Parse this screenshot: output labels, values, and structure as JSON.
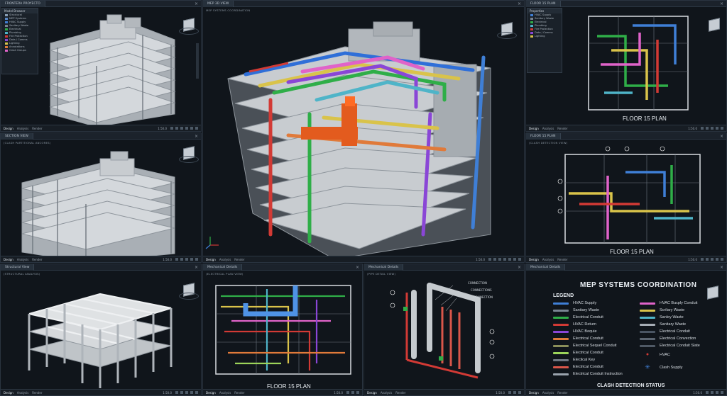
{
  "panes": {
    "p1": {
      "tab": "FRONTERA PROYECTO",
      "footer": [
        "Design",
        "Analysis",
        "Render"
      ],
      "zoom": "1:50.0"
    },
    "p2": {
      "tab": "SECTION VIEW",
      "subtitle": "(CLASH PARTITIONAL ANCORES)",
      "footer": [
        "Design",
        "Analysis",
        "Render"
      ],
      "zoom": "1:50.0"
    },
    "p3": {
      "tab": "Structural View",
      "subtitle": "(STRUCTURAL ANALYSIS)",
      "footer": [
        "Design",
        "Analysis",
        "Render"
      ],
      "zoom": "1:50.0"
    },
    "main": {
      "tab": "MEP 3D VIEW",
      "subtitle": "MEP SYSTEMS COORDINATION",
      "footer": [
        "Design",
        "Analysis",
        "Render"
      ],
      "zoom": "1:50.0"
    },
    "floor_top": {
      "tab": "FLOOR 15 PLAN",
      "footer": [
        "Design",
        "Analysis",
        "Render"
      ],
      "zoom": "1:50.0",
      "label": "FLOOR 15 PLAN"
    },
    "floor_mid": {
      "tab": "FLOOR 15 PLAN",
      "subtitle": "(CLASH DETECTION VIEW)",
      "footer": [
        "Design",
        "Analysis",
        "Render"
      ],
      "zoom": "1:50.0",
      "label": "FLOOR 15 PLAN"
    },
    "plan_bot": {
      "tab": "Mechanical Details",
      "subtitle": "(ELECTRICAL PLAN VIEW)",
      "footer": [
        "Design",
        "Analysis",
        "Render"
      ],
      "zoom": "1:50.0",
      "label": "FLOOR 15 PLAN"
    },
    "detail": {
      "tab": "Mechanical Details",
      "subtitle": "(PIPE DETAIL VIEW)",
      "footer": [
        "Design",
        "Analysis",
        "Render"
      ],
      "zoom": "1:50.0",
      "callouts": [
        "CONNECTION",
        "CONNECTIONS",
        "CONNECTION"
      ]
    },
    "legend": {
      "tab": "Mechanical Details",
      "footer": [
        "Design",
        "Analysis",
        "Render"
      ],
      "zoom": "1:50.0"
    }
  },
  "legend": {
    "title": "MEP SYSTEMS COORDINATION",
    "heading": "LEGEND",
    "left": [
      {
        "label": "HVAC Supply",
        "color": "#3f7fd6"
      },
      {
        "label": "Sanitary Waste",
        "color": "#7a8592"
      },
      {
        "label": "Electrical Conduit",
        "color": "#2fae48"
      },
      {
        "label": "HVAC Return",
        "color": "#d23a35"
      },
      {
        "label": "HVAC Bequie",
        "color": "#8a46d6"
      },
      {
        "label": "Electrical Conduit",
        "color": "#e07a3a"
      },
      {
        "label": "Electrical Sequel Conduit",
        "color": "#8b8f5a"
      },
      {
        "label": "Electrical Conduit",
        "color": "#9cd45a"
      },
      {
        "label": "Eleclical Key",
        "color": "#6f7884"
      },
      {
        "label": "Electrical Conduit",
        "color": "#d9564a"
      },
      {
        "label": "Electrical Conduit Instruction",
        "color": "#9aa3ad"
      }
    ],
    "right": [
      {
        "label": "HVAC Bucply Conduit",
        "color": "#e063c9"
      },
      {
        "label": "Scrilary Waste",
        "color": "#d9c34a"
      },
      {
        "label": "Sanley Waste",
        "color": "#4fb4c8"
      },
      {
        "label": "Sanitary Waste",
        "color": "#a6adb5"
      },
      {
        "label": "Electrical Conduit",
        "color": "#4a5563"
      },
      {
        "label": "Electrical Convection",
        "color": "#5b6571"
      },
      {
        "label": "Electrical Conduit Slate",
        "color": "#4f5965"
      },
      {
        "label": "HVAC",
        "color": "#d23a35"
      },
      {
        "label": "Clash Supply",
        "color": "#3f7fd6"
      }
    ],
    "footer": "CLASH DETECTION STATUS"
  },
  "sidebar_tl": {
    "title": "Model Browser",
    "items": [
      "Structural",
      "MEP Systems",
      "HVAC Supply",
      "Sanitary Waste",
      "Electrical",
      "Plumbing",
      "Fire Protection",
      "Data / Comms",
      "Lighting",
      "Annotations",
      "Clash Groups"
    ]
  },
  "sidebar_tr": {
    "title": "Properties",
    "items": [
      "HVAC Supply",
      "Sanitary Waste",
      "Electrical",
      "Plumbing",
      "Fire Protection",
      "Data / Comms",
      "Lighting"
    ]
  }
}
